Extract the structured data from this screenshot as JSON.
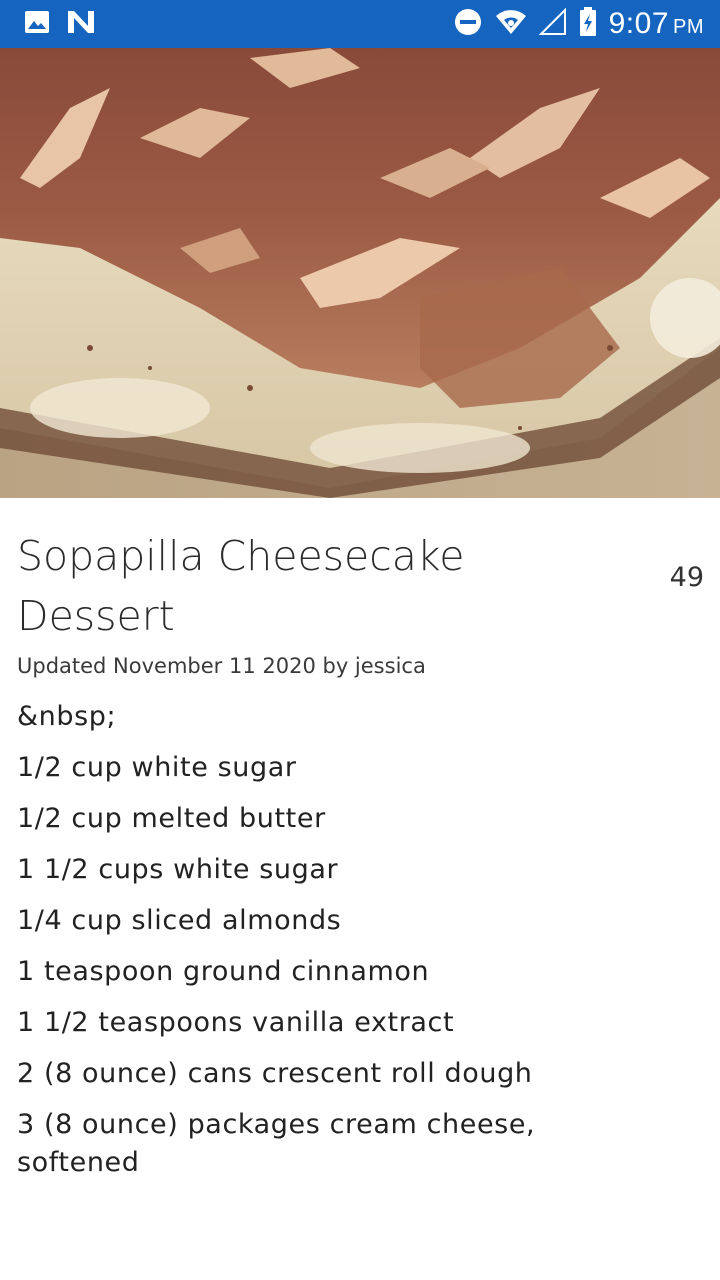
{
  "status_bar": {
    "time": "9:07",
    "ampm": "PM",
    "icons": [
      "image-icon",
      "n-icon",
      "do-not-disturb-icon",
      "wifi-icon",
      "signal-icon",
      "battery-charging-icon"
    ],
    "background": "#1565c0"
  },
  "hero": {
    "icon": "photo-sopapilla-cheesecake"
  },
  "recipe": {
    "title": "Sopapilla Cheesecake Dessert",
    "rating_count": "49",
    "updated": "Updated November 11 2020 by jessica",
    "ingredients": [
      "&nbsp;",
      "1/2 cup white sugar",
      "1/2 cup melted butter",
      "1 1/2 cups white sugar",
      "1/4 cup sliced almonds",
      "1 teaspoon ground cinnamon",
      "1 1/2 teaspoons vanilla extract",
      "2 (8 ounce) cans crescent roll dough",
      "3 (8 ounce) packages cream cheese, softened"
    ]
  }
}
